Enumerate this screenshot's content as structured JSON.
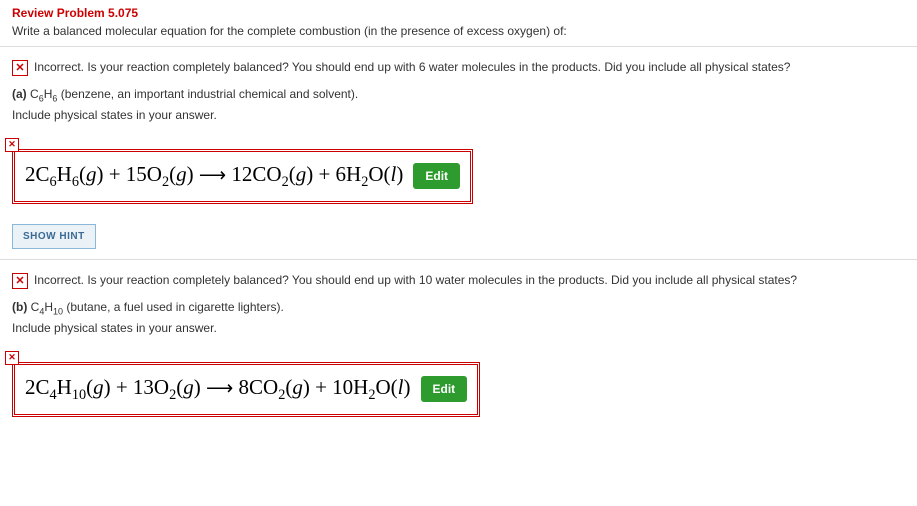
{
  "header": {
    "title": "Review Problem 5.075",
    "prompt": "Write a balanced molecular equation for the complete combustion (in the presence of excess oxygen) of:"
  },
  "partA": {
    "feedback": "Incorrect. Is your reaction completely balanced? You should end up with 6 water molecules in the products. Did you include all physical states?",
    "label_bold": "(a)",
    "formula_html": "C<sub>6</sub>H<sub>6</sub>",
    "label_rest": " (benzene, an important industrial chemical and solvent).",
    "label_line2": "Include physical states in your answer.",
    "equation_html": "2C<sub>6</sub>H<sub>6</sub>(<span class=\"state\">g</span>) + 15O<sub>2</sub>(<span class=\"state\">g</span>) <span class=\"arrow\">&#10230;</span> 12CO<sub>2</sub>(<span class=\"state\">g</span>) + 6H<sub>2</sub>O(<span class=\"state\">l</span>)",
    "edit_label": "Edit",
    "hint_label": "SHOW HINT"
  },
  "partB": {
    "feedback": "Incorrect. Is your reaction completely balanced? You should end up with 10 water molecules in the products. Did you include all physical states?",
    "label_bold": "(b)",
    "formula_html": "C<sub>4</sub>H<sub>10</sub>",
    "label_rest": " (butane, a fuel used in cigarette lighters).",
    "label_line2": "Include physical states in your answer.",
    "equation_html": "2C<sub>4</sub>H<sub>10</sub>(<span class=\"state\">g</span>) + 13O<sub>2</sub>(<span class=\"state\">g</span>) <span class=\"arrow\">&#10230;</span> 8CO<sub>2</sub>(<span class=\"state\">g</span>) + 10H<sub>2</sub>O(<span class=\"state\">l</span>)",
    "edit_label": "Edit"
  }
}
